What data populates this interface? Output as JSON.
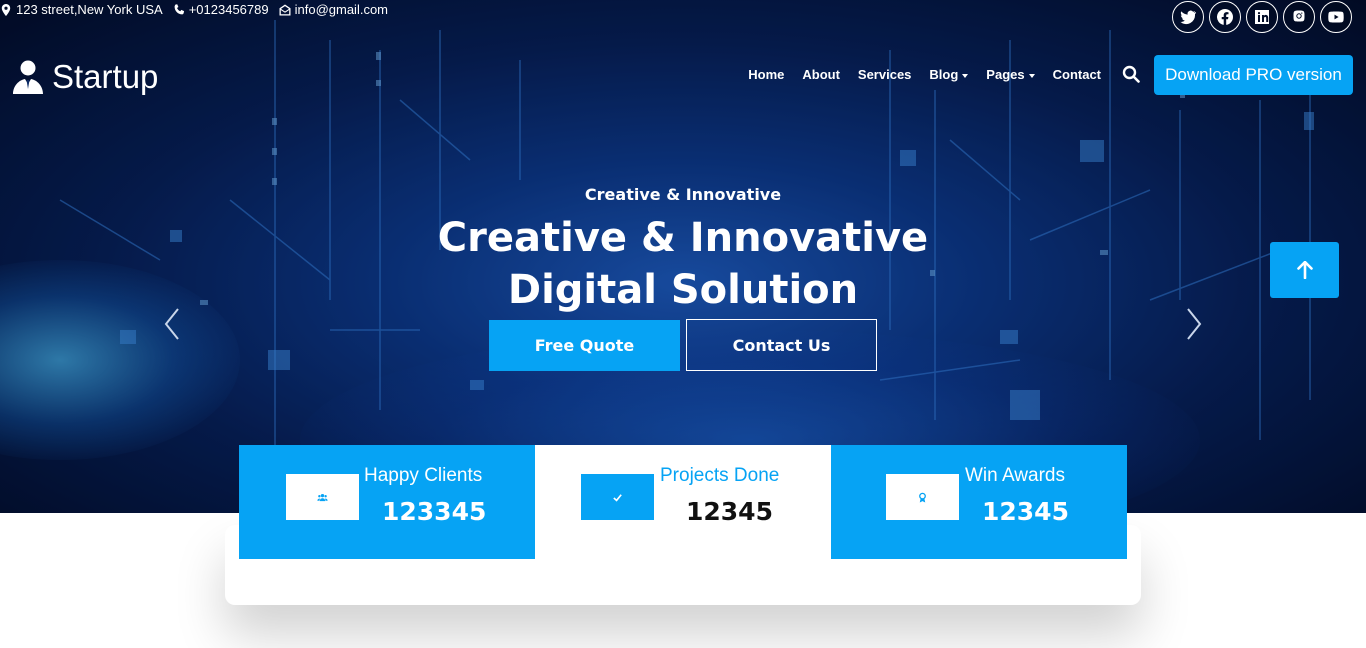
{
  "topbar": {
    "address": "123 street,New York USA",
    "phone": "+0123456789",
    "email": "info@gmail.com",
    "socials": [
      "twitter-icon",
      "facebook-icon",
      "linkedin-icon",
      "instagram-icon",
      "youtube-icon"
    ]
  },
  "brand": {
    "name": "Startup",
    "icon": "user-tie-icon"
  },
  "nav": {
    "items": [
      {
        "label": "Home",
        "dropdown": false
      },
      {
        "label": "About",
        "dropdown": false
      },
      {
        "label": "Services",
        "dropdown": false
      },
      {
        "label": "Blog",
        "dropdown": true
      },
      {
        "label": "Pages",
        "dropdown": true
      },
      {
        "label": "Contact",
        "dropdown": false
      }
    ],
    "search_icon": "search-icon",
    "cta_label": "Download PRO version"
  },
  "hero": {
    "subtitle": "Creative & Innovative",
    "title_line1": "Creative & Innovative",
    "title_line2": "Digital Solution",
    "primary_button": "Free Quote",
    "secondary_button": "Contact Us"
  },
  "stats": [
    {
      "label": "Happy Clients",
      "value": "123345",
      "icon": "users-icon",
      "style": "blue"
    },
    {
      "label": "Projects Done",
      "value": "12345",
      "icon": "check-icon",
      "style": "white"
    },
    {
      "label": "Win Awards",
      "value": "12345",
      "icon": "award-icon",
      "style": "blue"
    }
  ],
  "colors": {
    "accent": "#06a3f4",
    "hero_dark": "#020a22",
    "hero_blue": "#0d3a8c"
  }
}
